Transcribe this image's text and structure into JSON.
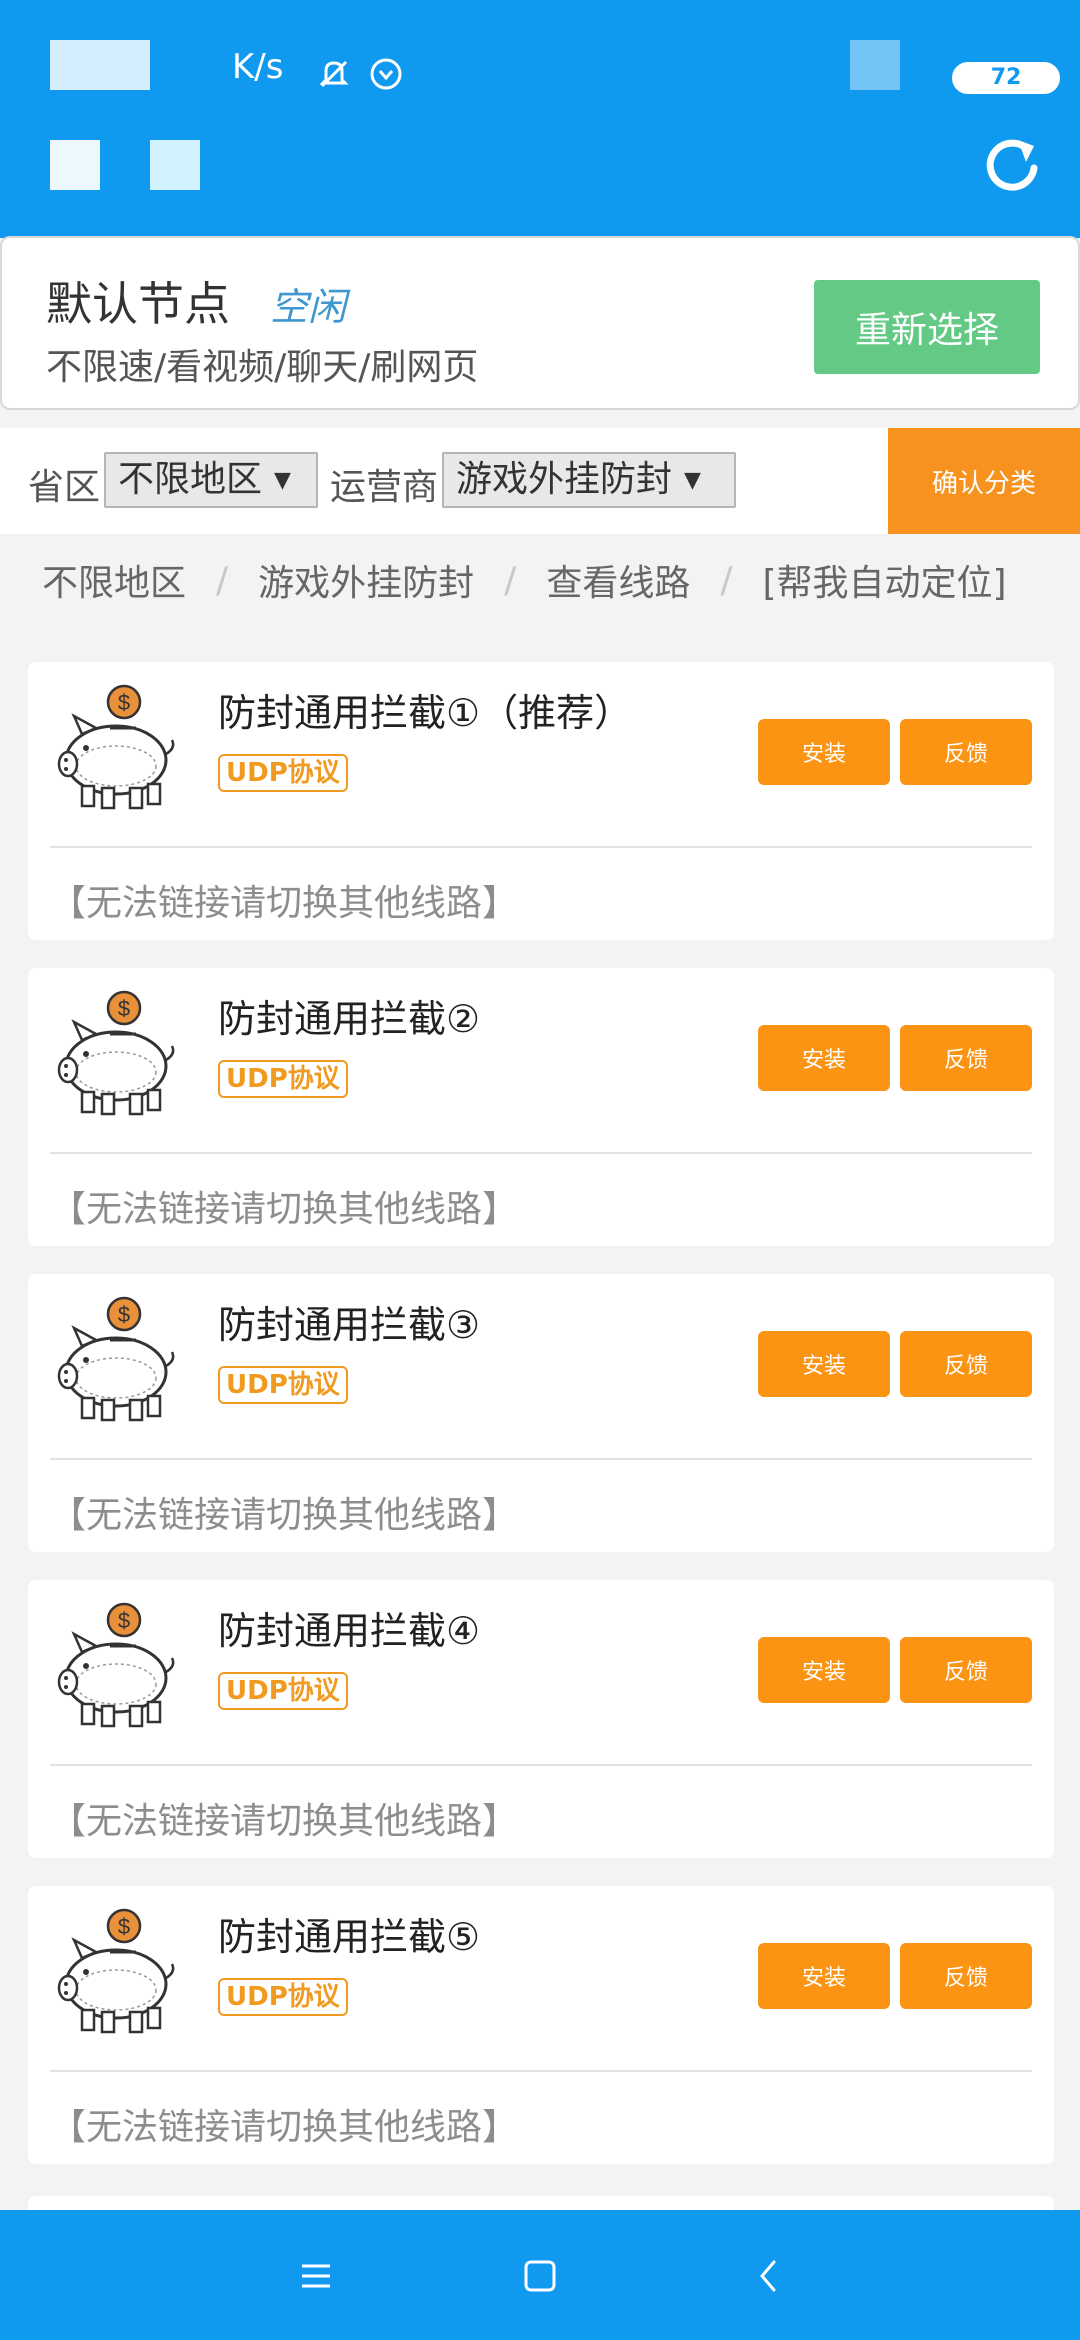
{
  "status_bar": {
    "speed_text": "K/s",
    "battery": "72",
    "colors": {
      "bar": "#0f9af0"
    }
  },
  "node": {
    "title": "默认节点",
    "status": "空闲",
    "subtitle": "不限速/看视频/聊天/刷网页",
    "reselect_label": "重新选择"
  },
  "filter": {
    "province_label": "省区",
    "province_value": "不限地区",
    "carrier_label": "运营商",
    "carrier_value": "游戏外挂防封",
    "confirm_label": "确认分类"
  },
  "breadcrumb": {
    "items": [
      "不限地区",
      "游戏外挂防封",
      "查看线路"
    ],
    "separator": "/",
    "auto_locate": "[帮我自动定位]"
  },
  "lines": [
    {
      "title": "防封通用拦截①（推荐）",
      "protocol": "UDP协议",
      "install": "安装",
      "feedback": "反馈",
      "note": "【无法链接请切换其他线路】"
    },
    {
      "title": "防封通用拦截②",
      "protocol": "UDP协议",
      "install": "安装",
      "feedback": "反馈",
      "note": "【无法链接请切换其他线路】"
    },
    {
      "title": "防封通用拦截③",
      "protocol": "UDP协议",
      "install": "安装",
      "feedback": "反馈",
      "note": "【无法链接请切换其他线路】"
    },
    {
      "title": "防封通用拦截④",
      "protocol": "UDP协议",
      "install": "安装",
      "feedback": "反馈",
      "note": "【无法链接请切换其他线路】"
    },
    {
      "title": "防封通用拦截⑤",
      "protocol": "UDP协议",
      "install": "安装",
      "feedback": "反馈",
      "note": "【无法链接请切换其他线路】"
    }
  ],
  "accent_colors": {
    "orange": "#fb9313",
    "green": "#63c984",
    "blue": "#0f9af0"
  }
}
